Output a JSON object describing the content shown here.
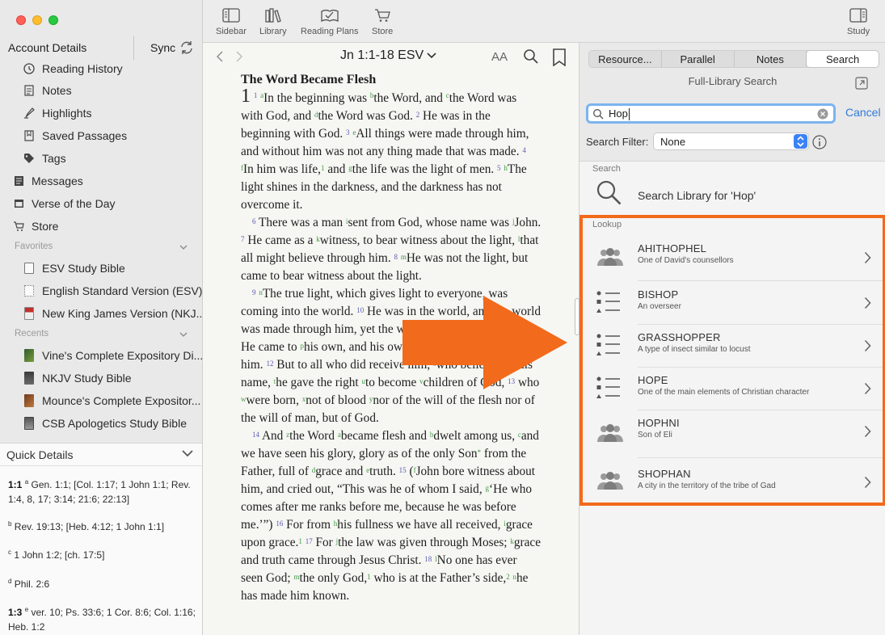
{
  "sidebar": {
    "account": "Account Details",
    "sync": "Sync",
    "items": [
      {
        "label": "Reading History",
        "icon": "history-icon"
      },
      {
        "label": "Notes",
        "icon": "notes-icon"
      },
      {
        "label": "Highlights",
        "icon": "highlighter-icon"
      },
      {
        "label": "Saved Passages",
        "icon": "saved-passage-icon"
      },
      {
        "label": "Tags",
        "icon": "tag-icon"
      },
      {
        "label": "Messages",
        "icon": "messages-icon"
      },
      {
        "label": "Verse of the Day",
        "icon": "calendar-icon"
      },
      {
        "label": "Store",
        "icon": "cart-icon"
      }
    ],
    "favorites_header": "Favorites",
    "favorites": [
      "ESV Study Bible",
      "English Standard Version (ESV)",
      "New King James Version (NKJ..."
    ],
    "recents_header": "Recents",
    "recents": [
      "Vine's Complete Expository Di...",
      "NKJV Study Bible",
      "Mounce's Complete Expositor...",
      "CSB Apologetics Study Bible"
    ],
    "quick_details": {
      "title": "Quick Details",
      "rows": [
        {
          "ref": "1:1",
          "mark": "a",
          "text": "Gen. 1:1; [Col. 1:17; 1 John 1:1; Rev. 1:4, 8, 17; 3:14; 21:6; 22:13]"
        },
        {
          "ref": "",
          "mark": "b",
          "text": "Rev. 19:13; [Heb. 4:12; 1 John 1:1]"
        },
        {
          "ref": "",
          "mark": "c",
          "text": "1 John 1:2; [ch. 17:5]"
        },
        {
          "ref": "",
          "mark": "d",
          "text": "Phil. 2:6"
        },
        {
          "ref": "1:3",
          "mark": "e",
          "text": "ver. 10; Ps. 33:6; 1 Cor. 8:6; Col. 1:16; Heb. 1:2"
        }
      ]
    }
  },
  "toolbar": {
    "sidebar": "Sidebar",
    "library": "Library",
    "reading_plans": "Reading Plans",
    "store": "Store",
    "study": "Study"
  },
  "reader": {
    "passage": "Jn 1:1-18 ESV",
    "font_size_label": "AA",
    "heading": "The Word Became Flesh"
  },
  "panel": {
    "tabs": [
      "Resource...",
      "Parallel",
      "Notes",
      "Search"
    ],
    "active_tab": "Search",
    "full_library_search": "Full-Library Search",
    "search_value": "Hop",
    "cancel": "Cancel",
    "filter_label": "Search Filter:",
    "filter_value": "None",
    "search_group": "Search",
    "search_library_text": "Search Library for 'Hop'",
    "lookup_group": "Lookup",
    "lookup": [
      {
        "title": "AHITHOPHEL",
        "subtitle": "One of David's counsellors",
        "icon": "people-icon"
      },
      {
        "title": "BISHOP",
        "subtitle": "An overseer",
        "icon": "topic-list-icon"
      },
      {
        "title": "GRASSHOPPER",
        "subtitle": "A type of insect similar to locust",
        "icon": "topic-list-icon"
      },
      {
        "title": "HOPE",
        "subtitle": "One of the main elements of Christian character",
        "icon": "topic-list-icon"
      },
      {
        "title": "HOPHNI",
        "subtitle": "Son of Eli",
        "icon": "people-icon"
      },
      {
        "title": "SHOPHAN",
        "subtitle": "A city in the territory of the tribe of Gad",
        "icon": "people-icon"
      }
    ]
  },
  "colors": {
    "highlight_border": "#f26a1b",
    "arrow": "#f26a1b",
    "link": "#2f7bd9"
  }
}
